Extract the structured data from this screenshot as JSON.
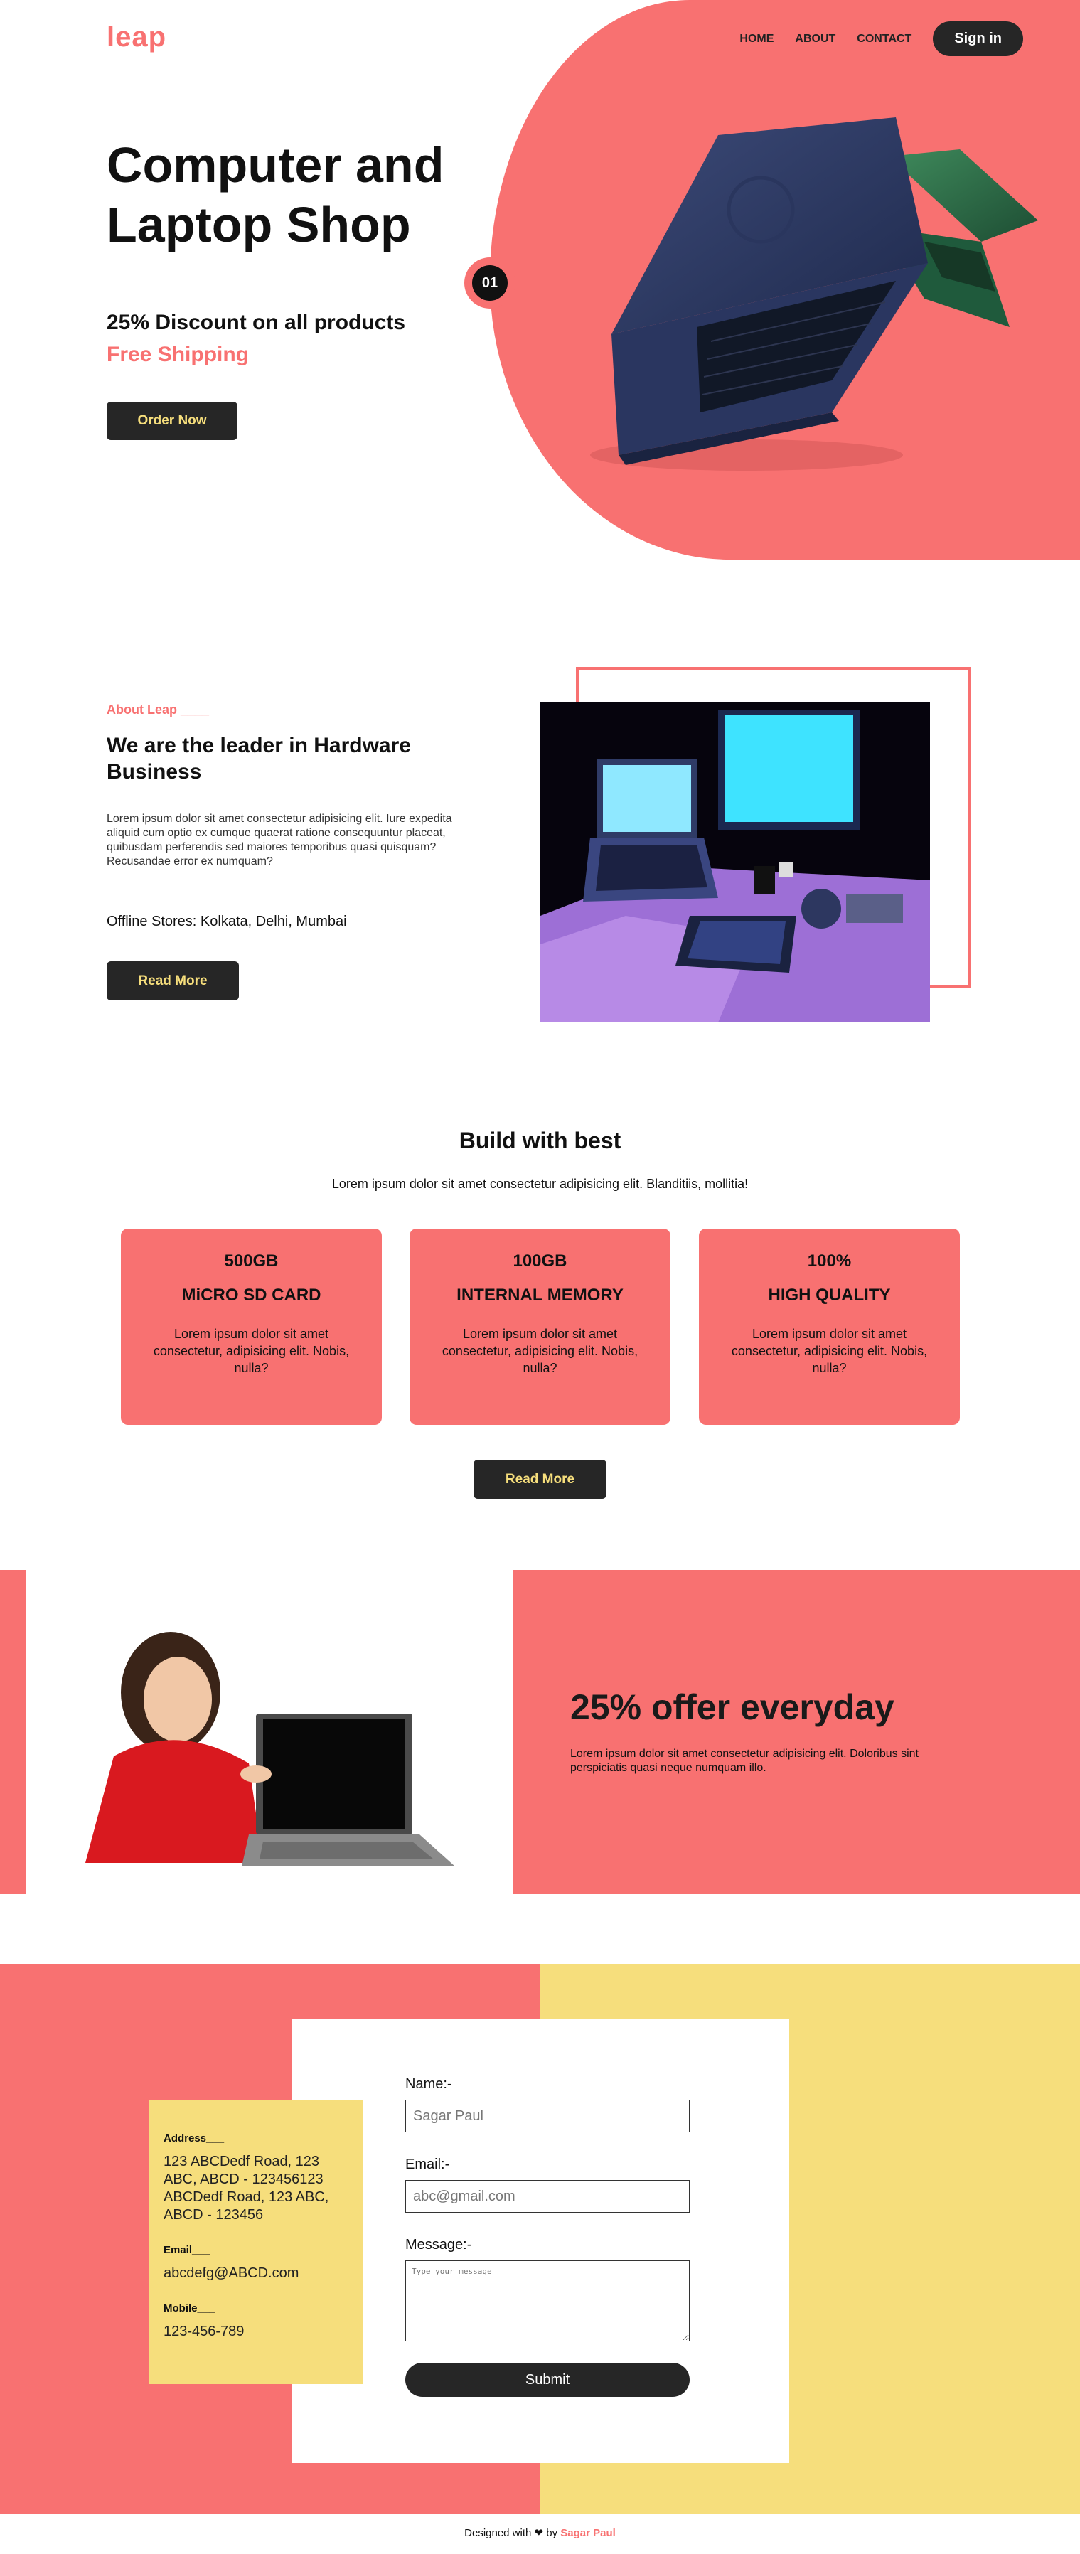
{
  "brand": {
    "logo": "leap",
    "accent": "#f87171",
    "yellow": "#f6de7c",
    "dark": "#262626"
  },
  "nav": {
    "items": [
      "HOME",
      "ABOUT",
      "CONTACT"
    ],
    "signin": "Sign in"
  },
  "hero": {
    "title": "Computer and Laptop Shop",
    "discount": "25% Discount on all products",
    "shipping": "Free Shipping",
    "cta": "Order Now",
    "slide_number": "01"
  },
  "about": {
    "tag": "About Leap ____",
    "heading": "We are the leader in Hardware Business",
    "text": "Lorem ipsum dolor sit amet consectetur adipisicing elit. Iure expedita aliquid cum optio ex cumque quaerat ratione consequuntur placeat, quibusdam perferendis sed maiores temporibus quasi quisquam? Recusandae error ex numquam?",
    "stores": "Offline Stores: Kolkata, Delhi, Mumbai",
    "cta": "Read More"
  },
  "build": {
    "title": "Build with best",
    "subtitle": "Lorem ipsum dolor sit amet consectetur adipisicing elit. Blanditiis, mollitia!",
    "cards": [
      {
        "value": "500GB",
        "title": "MiCRO SD CARD",
        "text": "Lorem ipsum dolor sit amet consectetur, adipisicing elit. Nobis, nulla?"
      },
      {
        "value": "100GB",
        "title": "INTERNAL MEMORY",
        "text": "Lorem ipsum dolor sit amet consectetur, adipisicing elit. Nobis, nulla?"
      },
      {
        "value": "100%",
        "title": "HIGH QUALITY",
        "text": "Lorem ipsum dolor sit amet consectetur, adipisicing elit. Nobis, nulla?"
      }
    ],
    "cta": "Read More"
  },
  "offer": {
    "title": "25% offer everyday",
    "text": "Lorem ipsum dolor sit amet consectetur adipisicing elit. Doloribus sint perspiciatis quasi neque numquam illo."
  },
  "contact": {
    "info": {
      "address_label": "Address___",
      "address": "123 ABCDedf Road, 123 ABC, ABCD - 123456123 ABCDedf Road, 123 ABC, ABCD - 123456",
      "email_label": "Email___",
      "email": "abcdefg@ABCD.com",
      "mobile_label": "Mobile___",
      "mobile": "123-456-789"
    },
    "form": {
      "name_label": "Name:-",
      "name_placeholder": "Sagar Paul",
      "email_label": "Email:-",
      "email_placeholder": "abc@gmail.com",
      "message_label": "Message:-",
      "message_placeholder": "Type your message",
      "submit": "Submit"
    }
  },
  "footer": {
    "prefix": "Designed with",
    "heart": "❤",
    "by": "by",
    "author": "Sagar Paul"
  }
}
